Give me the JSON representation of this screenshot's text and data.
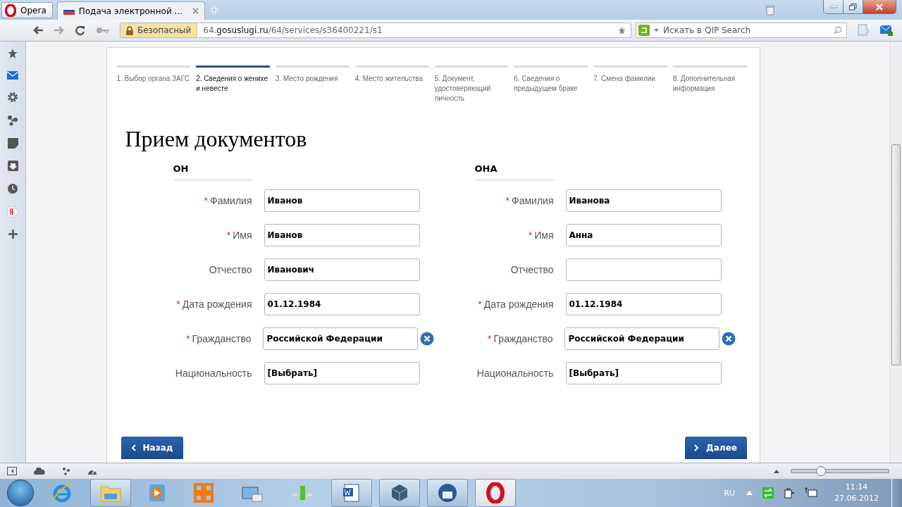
{
  "browser": {
    "menu_label": "Opera",
    "tabs": [
      {
        "title": "Подача электронной ...",
        "selected": true
      }
    ],
    "nav": {
      "security_label": "Безопасный",
      "url_host_prefix": "64.",
      "url_host": "gosuslugi.ru",
      "url_path": "/64/services/s36400221/s1",
      "search_placeholder": "Искать в QIP Search"
    },
    "zoom": {
      "level": 0.3
    }
  },
  "steps": [
    {
      "label": "1. Выбор органа ЗАГС",
      "selected": false
    },
    {
      "label": "2. Сведения о женихе и невесте",
      "selected": true
    },
    {
      "label": "3. Место рождения",
      "selected": false
    },
    {
      "label": "4. Место жительства",
      "selected": false
    },
    {
      "label": "5. Документ, удостоверяющий личность",
      "selected": false
    },
    {
      "label": "6. Сведения о предыдущем браке",
      "selected": false
    },
    {
      "label": "7. Смена фамилии",
      "selected": false
    },
    {
      "label": "8. Дополнительная информация",
      "selected": false
    }
  ],
  "heading": "Прием документов",
  "persons": [
    {
      "title": "ОН",
      "fields": [
        {
          "label": "Фамилия",
          "required": true,
          "value": "Иванов",
          "clearable": false
        },
        {
          "label": "Имя",
          "required": true,
          "value": "Иванов",
          "clearable": false
        },
        {
          "label": "Отчество",
          "required": false,
          "value": "Иванович",
          "clearable": false
        },
        {
          "label": "Дата рождения",
          "required": true,
          "value": "01.12.1984",
          "clearable": false
        },
        {
          "label": "Гражданство",
          "required": true,
          "value": "Российской Федерации",
          "clearable": true
        },
        {
          "label": "Национальность",
          "required": false,
          "value": "[Выбрать]",
          "clearable": false
        }
      ]
    },
    {
      "title": "ОНА",
      "fields": [
        {
          "label": "Фамилия",
          "required": true,
          "value": "Иванова",
          "clearable": false
        },
        {
          "label": "Имя",
          "required": true,
          "value": "Анна",
          "clearable": false
        },
        {
          "label": "Отчество",
          "required": false,
          "clearable": false
        },
        {
          "label": "Дата рождения",
          "required": true,
          "value": "01.12.1984",
          "clearable": false
        },
        {
          "label": "Гражданство",
          "required": true,
          "value": "Российской Федерации",
          "clearable": true
        },
        {
          "label": "Национальность",
          "required": false,
          "value": "[Выбрать]",
          "clearable": false
        }
      ]
    }
  ],
  "required_mark": "*",
  "buttons": {
    "back": "Назад",
    "next": "Далее"
  },
  "taskbar": {
    "language": "RU",
    "time": "11:14",
    "date": "27.06.2012"
  }
}
